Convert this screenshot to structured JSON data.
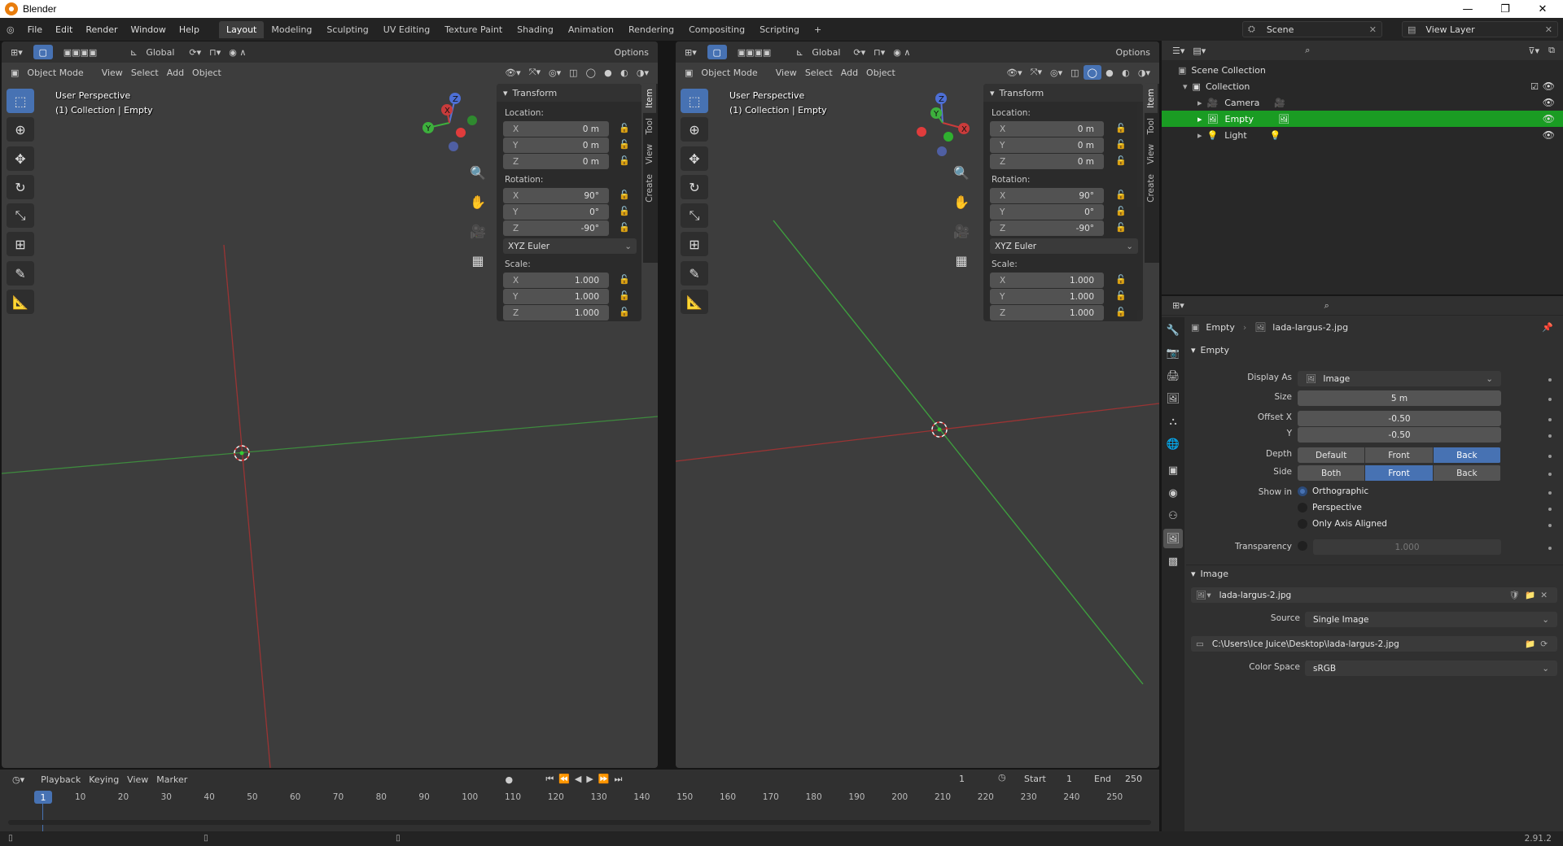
{
  "window": {
    "title": "Blender",
    "minimize": "—",
    "restore": "❐",
    "close": "✕"
  },
  "menu": {
    "items": [
      "File",
      "Edit",
      "Render",
      "Window",
      "Help"
    ]
  },
  "workspaces": [
    "Layout",
    "Modeling",
    "Sculpting",
    "UV Editing",
    "Texture Paint",
    "Shading",
    "Animation",
    "Rendering",
    "Compositing",
    "Scripting"
  ],
  "workspace_add": "+",
  "scene": {
    "name": "Scene",
    "view_layer": "View Layer"
  },
  "viewport_left": {
    "transform_orientation": "Global",
    "options": "Options",
    "mode": "Object Mode",
    "menus": [
      "View",
      "Select",
      "Add",
      "Object"
    ],
    "label_line1": "User Perspective",
    "label_line2": "(1) Collection | Empty"
  },
  "viewport_right": {
    "transform_orientation": "Global",
    "options": "Options",
    "mode": "Object Mode",
    "menus": [
      "View",
      "Select",
      "Add",
      "Object"
    ],
    "label_line1": "User Perspective",
    "label_line2": "(1) Collection | Empty"
  },
  "npanel": {
    "header": "Transform",
    "location_label": "Location:",
    "rotation_label": "Rotation:",
    "scale_label": "Scale:",
    "axes": [
      "X",
      "Y",
      "Z"
    ],
    "location": [
      "0 m",
      "0 m",
      "0 m"
    ],
    "rotation": [
      "90°",
      "0°",
      "-90°"
    ],
    "rotation_mode": "XYZ Euler",
    "scale": [
      "1.000",
      "1.000",
      "1.000"
    ],
    "tabs": [
      "Item",
      "Tool",
      "View",
      "Create"
    ]
  },
  "gizmo": {
    "x": "X",
    "y": "Y",
    "z": "Z"
  },
  "outliner": {
    "root": "Scene Collection",
    "collection": "Collection",
    "items": [
      "Camera",
      "Empty",
      "Light"
    ]
  },
  "properties": {
    "breadcrumb_object": "Empty",
    "breadcrumb_data": "lada-largus-2.jpg",
    "empty_panel": "Empty",
    "display_as_label": "Display As",
    "display_as": "Image",
    "size_label": "Size",
    "size": "5 m",
    "offset_x_label": "Offset X",
    "offset_x": "-0.50",
    "offset_y_label": "Y",
    "offset_y": "-0.50",
    "depth_label": "Depth",
    "depth_options": [
      "Default",
      "Front",
      "Back"
    ],
    "side_label": "Side",
    "side_options": [
      "Both",
      "Front",
      "Back"
    ],
    "show_in_label": "Show in",
    "show_in": [
      "Orthographic",
      "Perspective",
      "Only Axis Aligned"
    ],
    "transparency_label": "Transparency",
    "transparency": "1.000",
    "image_panel": "Image",
    "image_name": "lada-largus-2.jpg",
    "source_label": "Source",
    "source": "Single Image",
    "filepath": "C:\\Users\\Ice Juice\\Desktop\\lada-largus-2.jpg",
    "colorspace_label": "Color Space",
    "colorspace": "sRGB"
  },
  "timeline": {
    "menus": [
      "Playback",
      "Keying",
      "View",
      "Marker"
    ],
    "current_frame": "1",
    "start_label": "Start",
    "start": "1",
    "end_label": "End",
    "end": "250",
    "ticks": [
      "10",
      "20",
      "30",
      "40",
      "50",
      "60",
      "70",
      "80",
      "90",
      "100",
      "110",
      "120",
      "130",
      "140",
      "150",
      "160",
      "170",
      "180",
      "190",
      "200",
      "210",
      "220",
      "230",
      "240",
      "250"
    ]
  },
  "status": {
    "version": "2.91.2"
  },
  "colors": {
    "accent": "#4772b3",
    "selected_row": "#1a9c23",
    "x_axis": "#c93b3b",
    "y_axis": "#3ea83e",
    "z_axis": "#4d6fd6"
  }
}
